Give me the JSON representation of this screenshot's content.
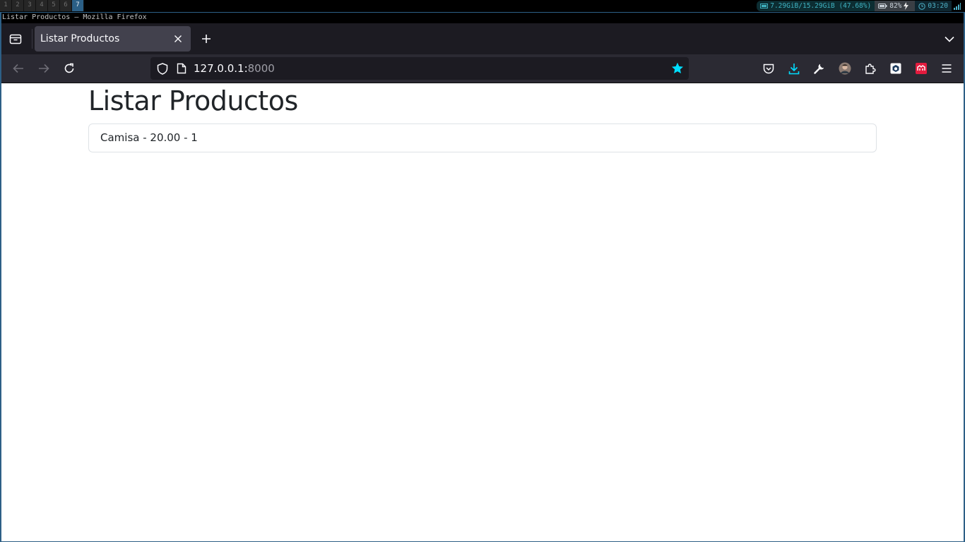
{
  "system_bar": {
    "workspaces": [
      "1",
      "2",
      "3",
      "4",
      "5",
      "6",
      "7"
    ],
    "active_workspace": "7",
    "memory": "7.29GiB/15.29GiB (47.68%)",
    "battery": "82%",
    "clock": "03:20"
  },
  "window": {
    "title": "Listar Productos — Mozilla Firefox"
  },
  "browser": {
    "tab_title": "Listar Productos",
    "url_host": "127.0.0.1:",
    "url_port": "8000",
    "accent_color": "#00ddff"
  },
  "page": {
    "title": "Listar Productos",
    "products": [
      "Camisa - 20.00 - 1"
    ]
  }
}
